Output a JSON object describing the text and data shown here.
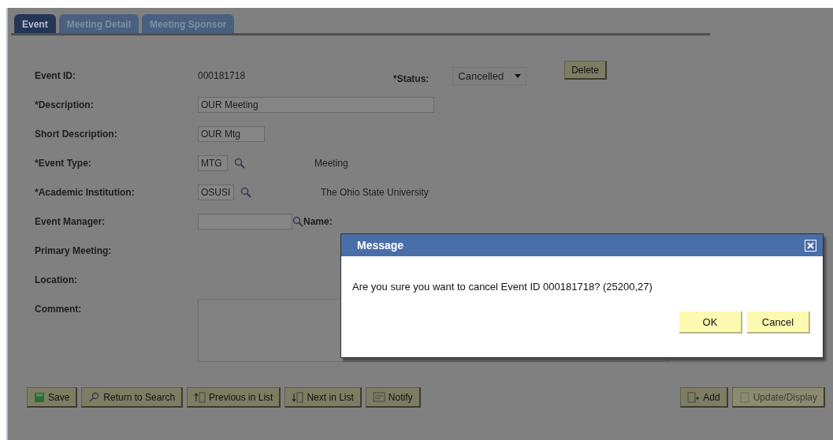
{
  "tabs": [
    {
      "label": "Event",
      "selected": true
    },
    {
      "label": "Meeting Detail",
      "selected": false
    },
    {
      "label": "Meeting Sponsor",
      "selected": false
    }
  ],
  "header": {
    "event_id_label": "Event ID:",
    "event_id": "000181718",
    "status_label": "*Status:",
    "status": "Cancelled",
    "delete_button": "Delete"
  },
  "fields": [
    {
      "kind": "input",
      "label": "*Description:",
      "value": "OUR Meeting"
    },
    {
      "kind": "input",
      "label": "Short Description:",
      "value": "OUR Mtg"
    },
    {
      "kind": "lookup",
      "label": "*Event Type:",
      "value": "MTG",
      "description": "Meeting"
    },
    {
      "kind": "lookup",
      "label": "*Academic Institution:",
      "value": "OSUSI",
      "description": "The Ohio State University"
    },
    {
      "kind": "manager",
      "label": "Event Manager:",
      "name_label": "Name:"
    },
    {
      "kind": "plain",
      "label": "Primary Meeting:"
    },
    {
      "kind": "plain",
      "label": "Location:"
    },
    {
      "kind": "textarea",
      "label": "Comment:"
    }
  ],
  "toolbar_left": [
    {
      "label": "Save"
    },
    {
      "label": "Return to Search"
    },
    {
      "label": "Previous in List"
    },
    {
      "label": "Next in List"
    },
    {
      "label": "Notify"
    }
  ],
  "toolbar_right": [
    {
      "label": "Add",
      "disabled": false
    },
    {
      "label": "Update/Display",
      "disabled": true
    }
  ],
  "dialog": {
    "title": "Message",
    "message": "Are you sure you want to cancel Event ID 000181718? (25200,27)",
    "buttons": [
      "OK",
      "Cancel"
    ]
  }
}
